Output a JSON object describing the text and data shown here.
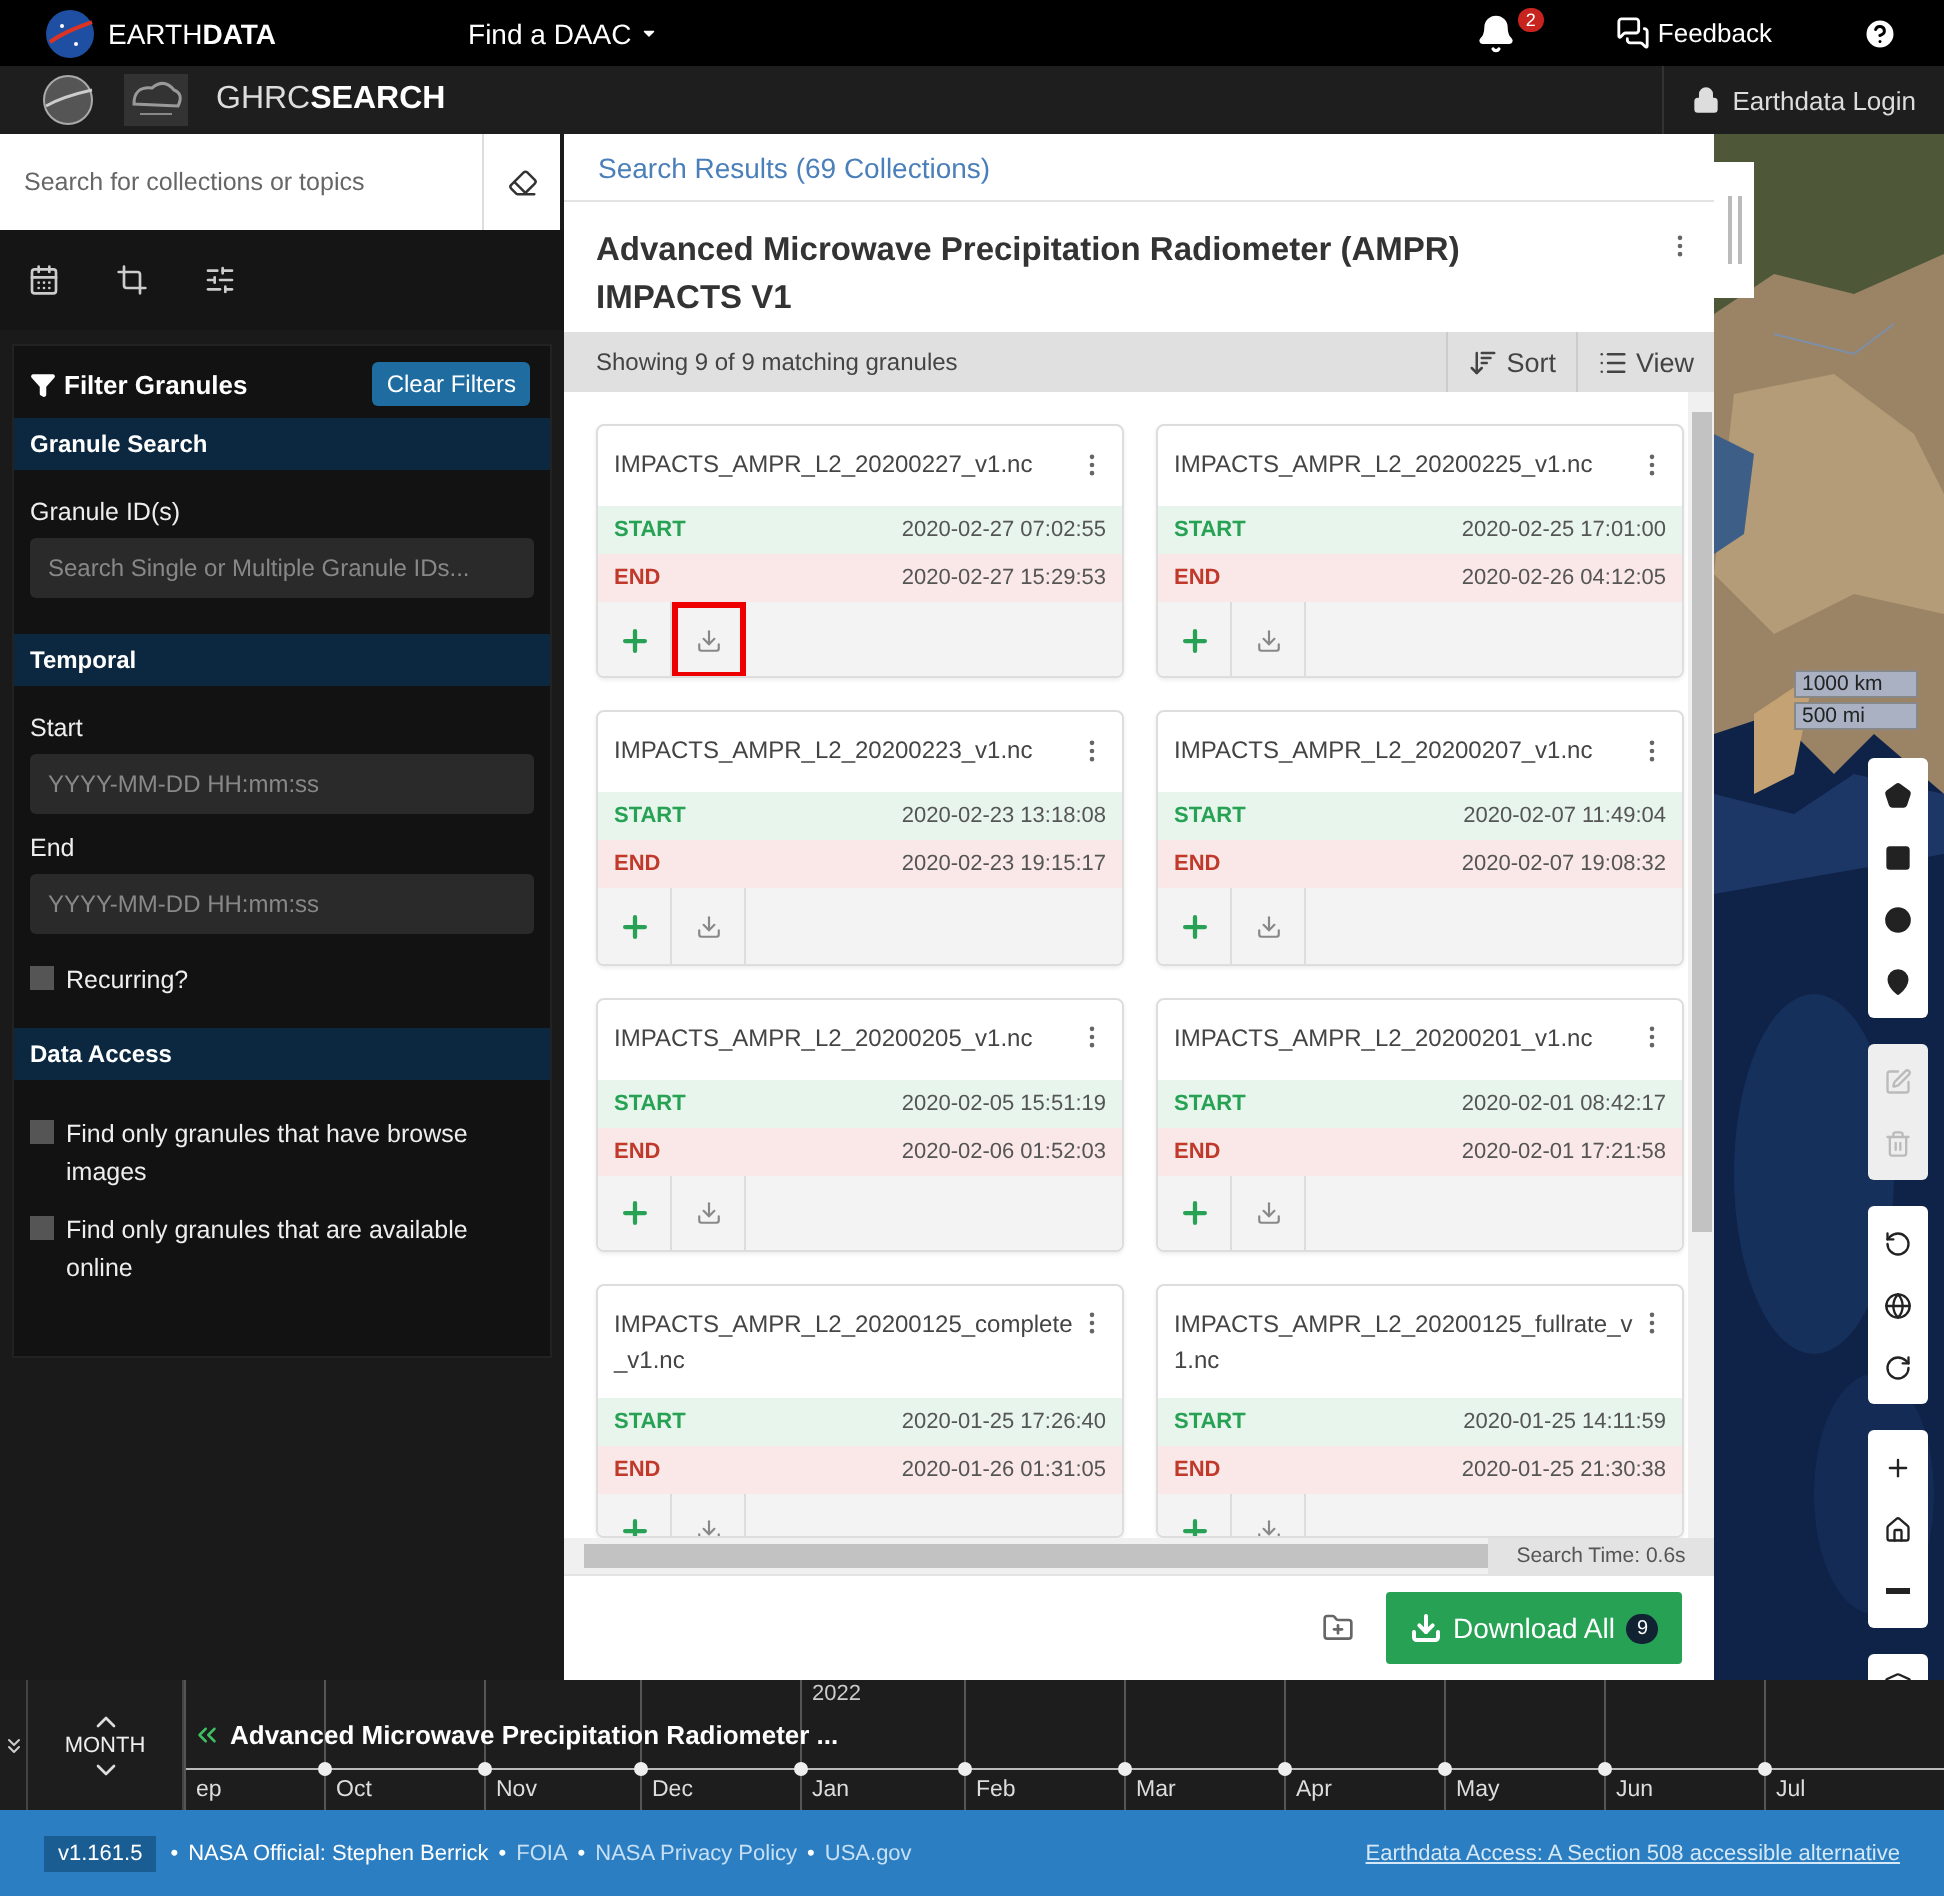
{
  "top_bar": {
    "brand_light": "EARTH",
    "brand_bold": "DATA",
    "daac_menu": "Find a DAAC",
    "notification_count": "2",
    "feedback": "Feedback"
  },
  "app_bar": {
    "title_light": "GHRC",
    "title_bold": "SEARCH",
    "login": "Earthdata Login"
  },
  "sidebar": {
    "search": {
      "placeholder": "Search for collections or topics"
    },
    "filter_title": "Filter Granules",
    "clear_button": "Clear Filters",
    "sections": [
      {
        "title": "Granule Search",
        "fields": [
          {
            "label": "Granule ID(s)",
            "placeholder": "Search Single or Multiple Granule IDs..."
          }
        ]
      },
      {
        "title": "Temporal",
        "fields": [
          {
            "label": "Start",
            "placeholder": "YYYY-MM-DD HH:mm:ss"
          },
          {
            "label": "End",
            "placeholder": "YYYY-MM-DD HH:mm:ss"
          }
        ],
        "checkboxes": [
          {
            "label": "Recurring?",
            "checked": false
          }
        ]
      },
      {
        "title": "Data Access",
        "checkboxes": [
          {
            "label": "Find only granules that have browse images",
            "checked": false
          },
          {
            "label": "Find only granules that are available online",
            "checked": false
          }
        ]
      }
    ]
  },
  "results": {
    "breadcrumb": "Search Results (69 Collections)",
    "collection_title": "Advanced Microwave Precipitation Radiometer (AMPR) IMPACTS V1",
    "summary": "Showing 9 of 9 matching granules",
    "sort": "Sort",
    "view": "View",
    "search_time": "Search Time: 0.6s",
    "download_all": "Download All",
    "download_count": "9",
    "granules": [
      {
        "name": "IMPACTS_AMPR_L2_20200227_v1.nc",
        "start_label": "START",
        "start": "2020-02-27 07:02:55",
        "end_label": "END",
        "end": "2020-02-27 15:29:53",
        "highlighted": true
      },
      {
        "name": "IMPACTS_AMPR_L2_20200225_v1.nc",
        "start_label": "START",
        "start": "2020-02-25 17:01:00",
        "end_label": "END",
        "end": "2020-02-26 04:12:05",
        "highlighted": false
      },
      {
        "name": "IMPACTS_AMPR_L2_20200223_v1.nc",
        "start_label": "START",
        "start": "2020-02-23 13:18:08",
        "end_label": "END",
        "end": "2020-02-23 19:15:17",
        "highlighted": false
      },
      {
        "name": "IMPACTS_AMPR_L2_20200207_v1.nc",
        "start_label": "START",
        "start": "2020-02-07 11:49:04",
        "end_label": "END",
        "end": "2020-02-07 19:08:32",
        "highlighted": false
      },
      {
        "name": "IMPACTS_AMPR_L2_20200205_v1.nc",
        "start_label": "START",
        "start": "2020-02-05 15:51:19",
        "end_label": "END",
        "end": "2020-02-06 01:52:03",
        "highlighted": false
      },
      {
        "name": "IMPACTS_AMPR_L2_20200201_v1.nc",
        "start_label": "START",
        "start": "2020-02-01 08:42:17",
        "end_label": "END",
        "end": "2020-02-01 17:21:58",
        "highlighted": false
      },
      {
        "name": "IMPACTS_AMPR_L2_20200125_complete_v1.nc",
        "start_label": "START",
        "start": "2020-01-25 17:26:40",
        "end_label": "END",
        "end": "2020-01-26 01:31:05",
        "highlighted": false
      },
      {
        "name": "IMPACTS_AMPR_L2_20200125_fullrate_v1.nc",
        "start_label": "START",
        "start": "2020-01-25 14:11:59",
        "end_label": "END",
        "end": "2020-01-25 21:30:38",
        "highlighted": false
      }
    ]
  },
  "map": {
    "scale_km": "1000 km",
    "scale_mi": "500 mi",
    "tool_groups": [
      {
        "disabled": false,
        "tools": [
          {
            "kind": "polygon"
          },
          {
            "kind": "rectangle"
          },
          {
            "kind": "circle"
          },
          {
            "kind": "point"
          }
        ]
      },
      {
        "disabled": true,
        "tools": [
          {
            "kind": "edit"
          },
          {
            "kind": "delete"
          }
        ]
      },
      {
        "disabled": false,
        "tools": [
          {
            "kind": "rotate-left"
          },
          {
            "kind": "globe"
          },
          {
            "kind": "rotate-right"
          }
        ]
      },
      {
        "disabled": false,
        "tools": [
          {
            "kind": "zoom-in"
          },
          {
            "kind": "home"
          },
          {
            "kind": "zoom-out"
          }
        ]
      },
      {
        "disabled": false,
        "tools": [
          {
            "kind": "layers"
          }
        ]
      }
    ]
  },
  "timeline": {
    "zoom_level": "MONTH",
    "year": "2022",
    "collection": "Advanced Microwave Precipitation Radiometer ...",
    "months": [
      "ep",
      "Oct",
      "Nov",
      "Dec",
      "Jan",
      "Feb",
      "Mar",
      "Apr",
      "May",
      "Jun",
      "Jul"
    ]
  },
  "footer": {
    "version": "v1.161.5",
    "separator": "•",
    "items": [
      {
        "text": "NASA Official: Stephen Berrick",
        "kind": "text"
      },
      {
        "text": "FOIA",
        "kind": "link"
      },
      {
        "text": "NASA Privacy Policy",
        "kind": "link"
      },
      {
        "text": "USA.gov",
        "kind": "link"
      }
    ],
    "accessible_link": "Earthdata Access: A Section 508 accessible alternative"
  }
}
